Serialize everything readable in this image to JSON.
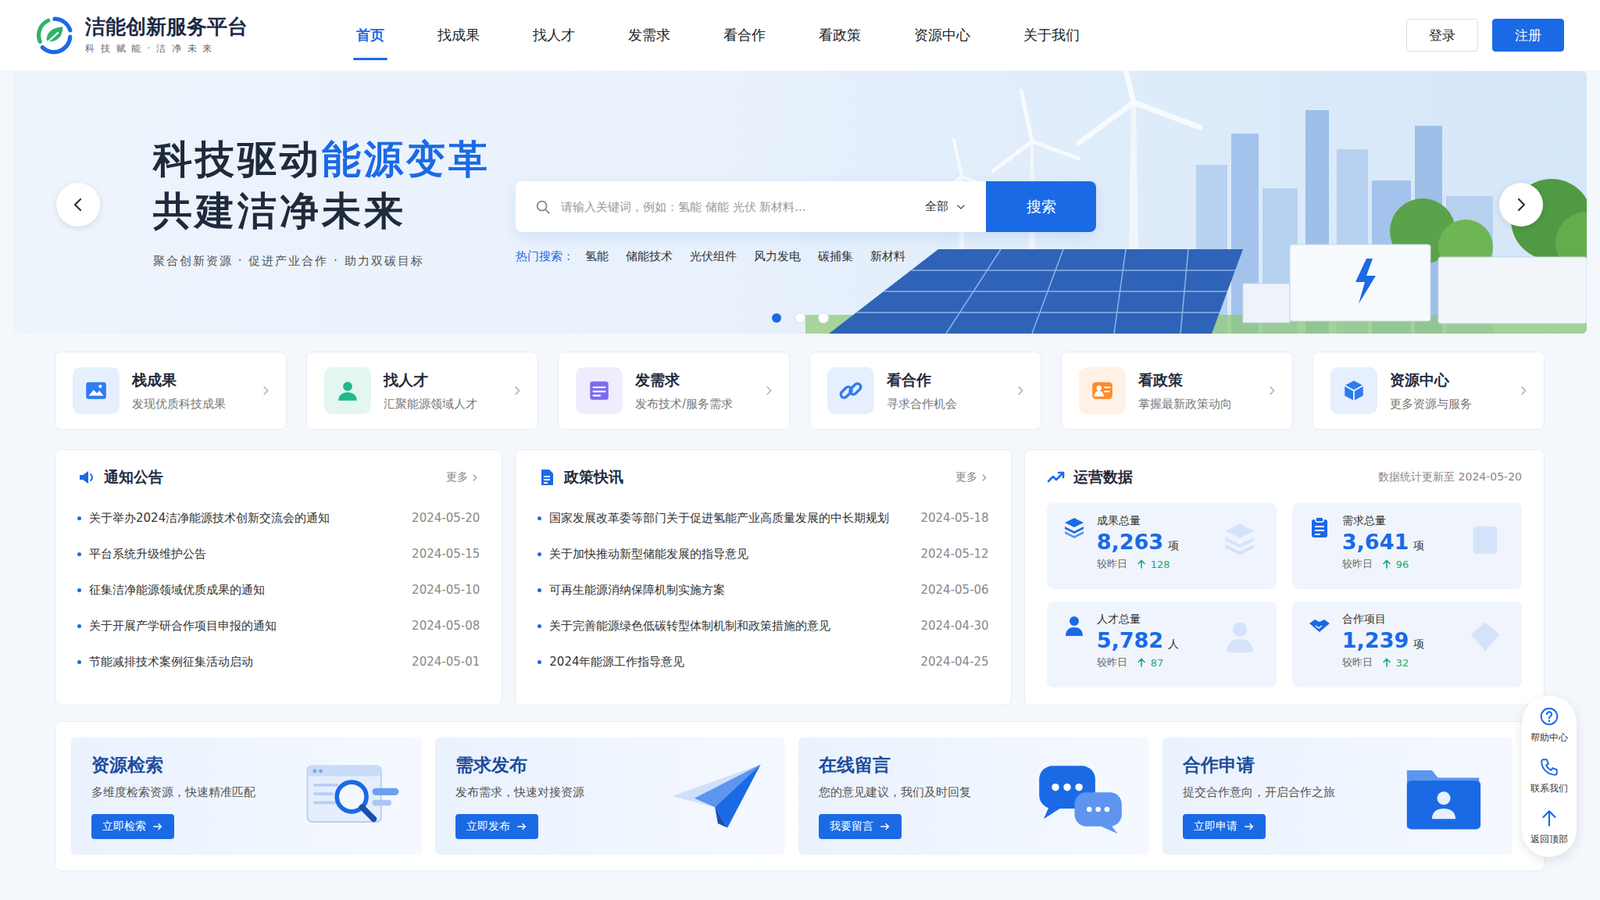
{
  "header": {
    "logo_title": "洁能创新服务平台",
    "logo_subtitle": "科 技 赋 能 · 洁 净 未 来",
    "nav": [
      {
        "label": "首页",
        "selected": true
      },
      {
        "label": "找成果",
        "selected": false
      },
      {
        "label": "找人才",
        "selected": false
      },
      {
        "label": "发需求",
        "selected": false
      },
      {
        "label": "看合作",
        "selected": false
      },
      {
        "label": "看政策",
        "selected": false
      },
      {
        "label": "资源中心",
        "selected": false
      },
      {
        "label": "关于我们",
        "selected": false
      }
    ],
    "login": "登录",
    "register": "注册"
  },
  "hero": {
    "title_plain": "科技驱动",
    "title_highlight": "能源变革",
    "title_line2": "共建洁净未来",
    "subtitle": "聚合创新资源 · 促进产业合作 · 助力双碳目标",
    "search": {
      "placeholder": "请输入关键词，例如：氢能 储能 光伏 新材料...",
      "scope": "全部",
      "button": "搜索"
    },
    "hot_label": "热门搜索：",
    "hot": [
      "氢能",
      "储能技术",
      "光伏组件",
      "风力发电",
      "碳捕集",
      "新材料"
    ],
    "slides": [
      {
        "selected": true
      },
      {
        "selected": false
      },
      {
        "selected": false
      }
    ]
  },
  "quick_links": [
    {
      "title": "栈成果",
      "desc": "发现优质科技成果",
      "color": "#2f7bf0"
    },
    {
      "title": "找人才",
      "desc": "汇聚能源领域人才",
      "color": "#1fb98a"
    },
    {
      "title": "发需求",
      "desc": "发布技术/服务需求",
      "color": "#7b6cf0"
    },
    {
      "title": "看合作",
      "desc": "寻求合作机会",
      "color": "#2f7bf0"
    },
    {
      "title": "看政策",
      "desc": "掌握最新政策动向",
      "color": "#ff8a2a"
    },
    {
      "title": "资源中心",
      "desc": "更多资源与服务",
      "color": "#2f7bf0"
    }
  ],
  "notices": {
    "title": "通知公告",
    "more": "更多",
    "items": [
      {
        "title": "关于举办2024洁净能源技术创新交流会的通知",
        "date": "2024-05-20"
      },
      {
        "title": "平台系统升级维护公告",
        "date": "2024-05-15"
      },
      {
        "title": "征集洁净能源领域优质成果的通知",
        "date": "2024-05-10"
      },
      {
        "title": "关于开展产学研合作项目申报的通知",
        "date": "2024-05-08"
      },
      {
        "title": "节能减排技术案例征集活动启动",
        "date": "2024-05-01"
      }
    ]
  },
  "policies": {
    "title": "政策快讯",
    "more": "更多",
    "items": [
      {
        "title": "国家发展改革委等部门关于促进氢能产业高质量发展的中长期规划",
        "date": "2024-05-18"
      },
      {
        "title": "关于加快推动新型储能发展的指导意见",
        "date": "2024-05-12"
      },
      {
        "title": "可再生能源消纳保障机制实施方案",
        "date": "2024-05-06"
      },
      {
        "title": "关于完善能源绿色低碳转型体制机制和政策措施的意见",
        "date": "2024-04-30"
      },
      {
        "title": "2024年能源工作指导意见",
        "date": "2024-04-25"
      }
    ]
  },
  "stats": {
    "title": "运营数据",
    "updated": "数据统计更新至 2024-05-20",
    "cards": [
      {
        "label": "成果总量",
        "value": "8,263",
        "unit": "项",
        "compare": "较昨日",
        "delta": "128"
      },
      {
        "label": "需求总量",
        "value": "3,641",
        "unit": "项",
        "compare": "较昨日",
        "delta": "96"
      },
      {
        "label": "人才总量",
        "value": "5,782",
        "unit": "人",
        "compare": "较昨日",
        "delta": "87"
      },
      {
        "label": "合作项目",
        "value": "1,239",
        "unit": "项",
        "compare": "较昨日",
        "delta": "32"
      }
    ]
  },
  "actions": [
    {
      "title": "资源检索",
      "desc": "多维度检索资源，快速精准匹配",
      "button": "立即检索"
    },
    {
      "title": "需求发布",
      "desc": "发布需求，快速对接资源",
      "button": "立即发布"
    },
    {
      "title": "在线留言",
      "desc": "您的意见建议，我们及时回复",
      "button": "我要留言"
    },
    {
      "title": "合作申请",
      "desc": "提交合作意向，开启合作之旅",
      "button": "立即申请"
    }
  ],
  "float_bar": [
    {
      "label": "帮助中心"
    },
    {
      "label": "联系我们"
    },
    {
      "label": "返回顶部"
    }
  ]
}
